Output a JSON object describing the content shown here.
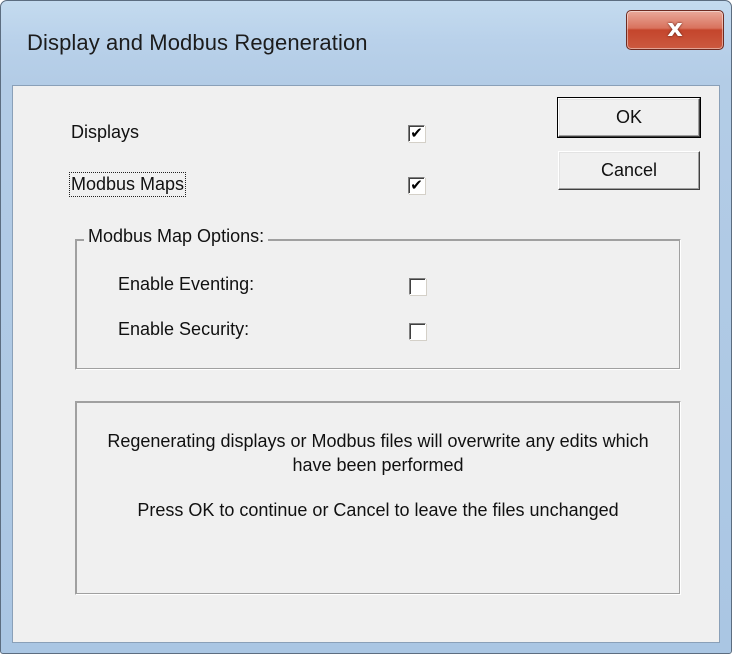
{
  "window": {
    "title": "Display and Modbus Regeneration",
    "close_glyph": "x",
    "close_icon": "close-icon"
  },
  "options": {
    "displays_label": "Displays",
    "displays_checked": true,
    "modbus_maps_label": "Modbus Maps",
    "modbus_maps_checked": true
  },
  "group": {
    "title": "Modbus Map Options:",
    "enable_eventing_label": "Enable Eventing:",
    "enable_eventing_checked": false,
    "enable_security_label": "Enable Security:",
    "enable_security_checked": false
  },
  "buttons": {
    "ok_label": "OK",
    "cancel_label": "Cancel"
  },
  "message": {
    "warning": "Regenerating displays or Modbus files will overwrite any edits which have been performed",
    "instruction": "Press OK to continue or Cancel to leave the files unchanged"
  },
  "checkmark_glyph": "✔",
  "colors": {
    "title_bar": "#b9d1ea",
    "client_bg": "#f0f0f0",
    "close_button": "#c4452c"
  }
}
